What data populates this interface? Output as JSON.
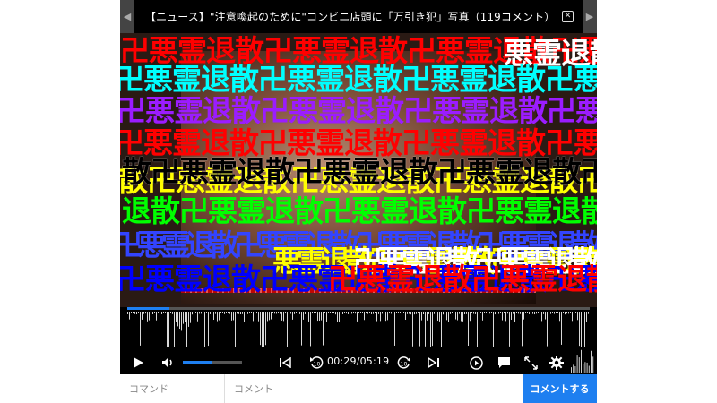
{
  "title_bar": {
    "title": "【ニュース】\"注意喚起のために\"コンビニ店頭に「万引き犯」写真（119コメント）",
    "close_label": "✕",
    "prev_label": "◀",
    "next_label": "▶"
  },
  "danmaku": [
    {
      "text": "卍悪霊退散卍悪霊退散卍悪霊退散卍悪霊退散",
      "color": "#ff0000"
    },
    {
      "text": "悪霊退散卍",
      "color": "#ffffff"
    },
    {
      "text": "卍悪霊退散卍悪霊退散卍悪霊退散卍悪霊退散",
      "color": "#00ffff"
    },
    {
      "text": "卍悪霊退散卍悪霊退散卍悪霊退散卍悪霊退散",
      "color": "#9b1cff"
    },
    {
      "text": "卍悪霊退散卍悪霊退散卍悪霊退散卍悪霊退散",
      "color": "#ff0000"
    },
    {
      "text": "散卍悪霊退散卍悪霊退散卍悪霊退散卍悪霊退散",
      "color": "#ffff00"
    },
    {
      "text": "散卍悪霊退散卍悪霊退散卍悪霊退散卍悪霊退散",
      "color": "#000000"
    },
    {
      "text": "退散卍悪霊退散卍悪霊退散卍悪霊退散卍悪霊",
      "color": "#00ff00"
    },
    {
      "text": "卍悪霊退散卍悪霊退散卍悪霊退散卍悪霊退散",
      "color": "#3344ff"
    },
    {
      "text": "悪霊退散卍悪霊退散卍悪霊退散卍悪霊退散",
      "color": "#ffff00"
    },
    {
      "text": "卍悪霊退散卍悪霊退散卍悪霊退散卍悪霊退散",
      "color": "#ffffff"
    },
    {
      "text": "卍悪霊退散卍悪霊退散卍悪霊退散卍悪霊退散",
      "color": "#0000ff"
    },
    {
      "text": "卍悪霊退散卍悪霊退散卍悪霊退散卍悪霊退散",
      "color": "#ff0000"
    }
  ],
  "player": {
    "current_time": "00:29",
    "duration": "05:19",
    "time_text": "00:29/05:19",
    "progress": 0.091,
    "volume": 0.5
  },
  "controls": {
    "play_icon": "play-icon",
    "volume_icon": "volume-icon",
    "skip_back_icon": "skip-to-start-icon",
    "rewind_icon": "rewind-10-icon",
    "forward_icon": "forward-10-icon",
    "skip_end_icon": "skip-to-end-icon",
    "loop_icon": "loop-icon",
    "comment_toggle_icon": "comment-toggle-icon",
    "fullscreen_icon": "fullscreen-icon",
    "settings_icon": "gear-icon",
    "rewind_label": "10",
    "forward_label": "10"
  },
  "bottom_bar": {
    "command_placeholder": "コマンド",
    "comment_placeholder": "コメント",
    "submit_label": "コメントする"
  },
  "colors": {
    "accent": "#1e7ff0",
    "player_bg": "#000000"
  }
}
